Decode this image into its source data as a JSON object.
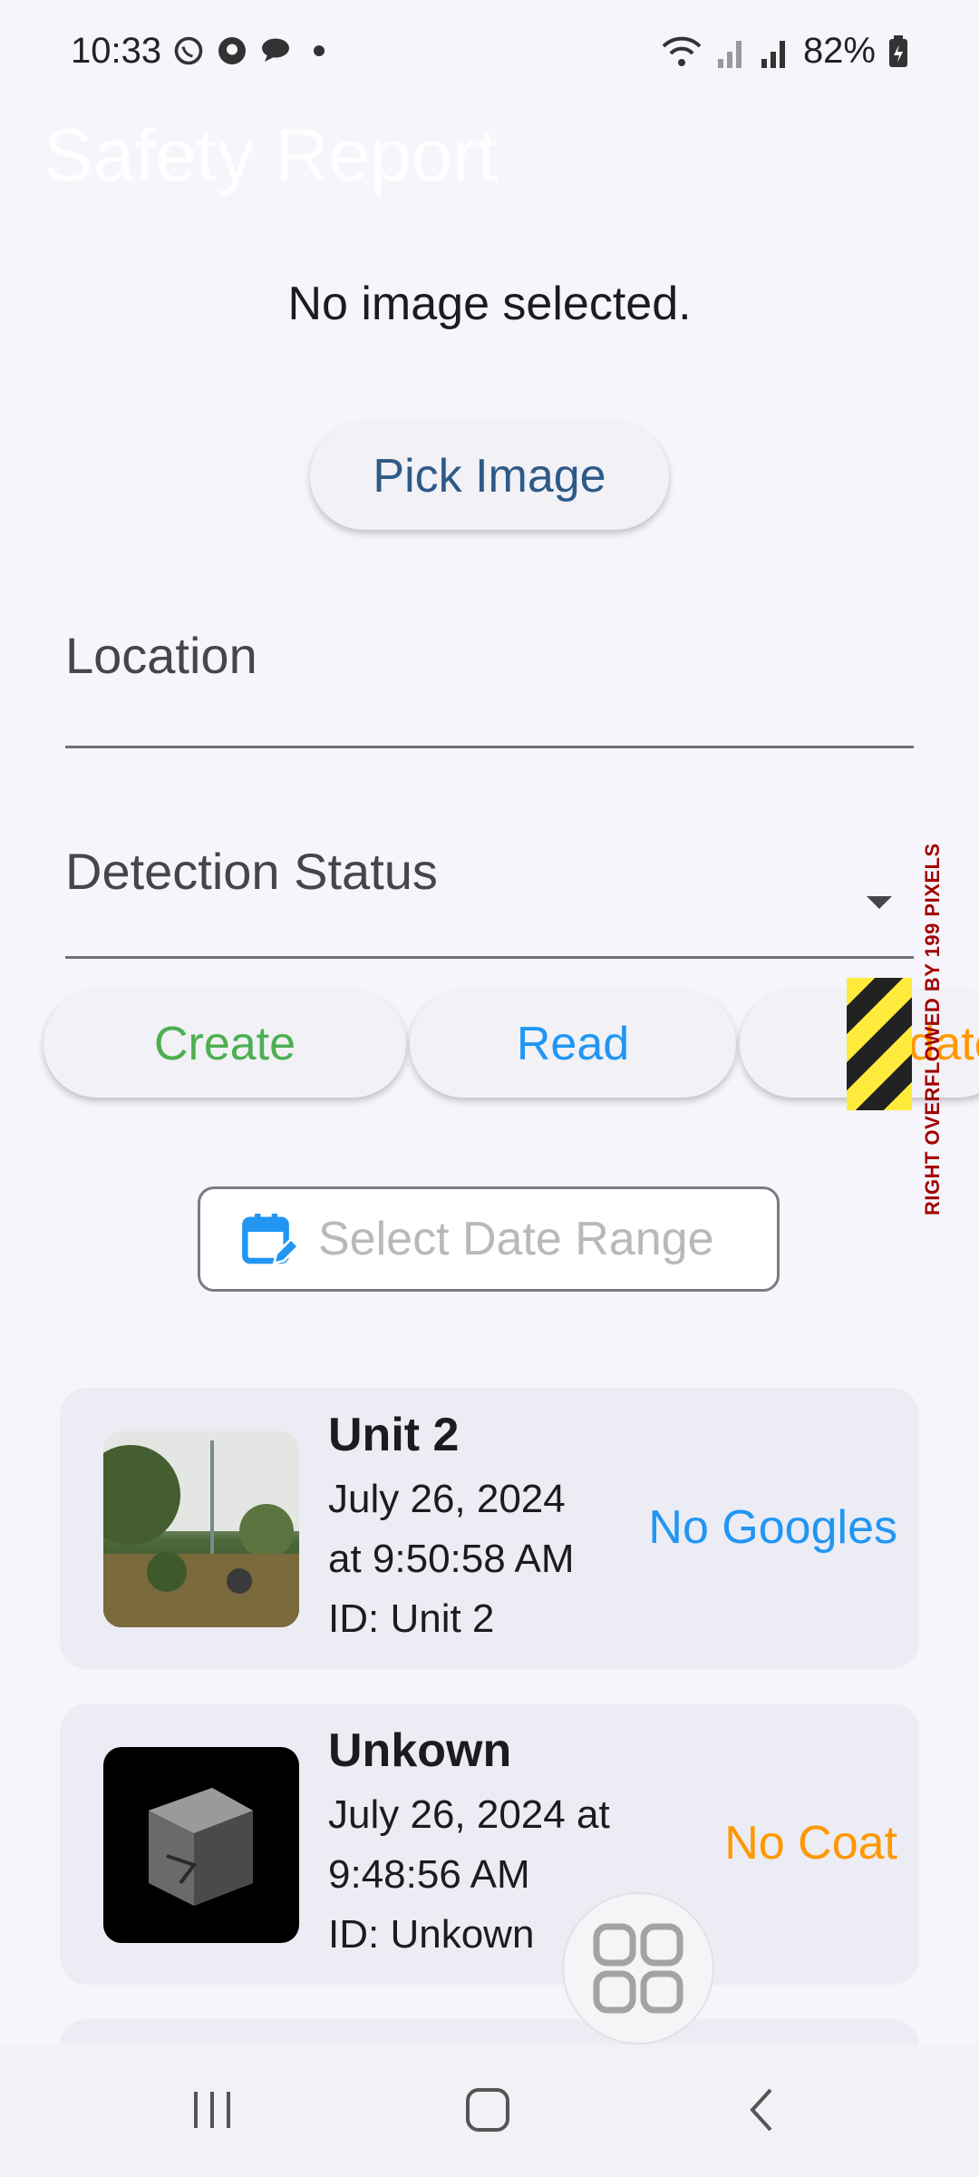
{
  "status_bar": {
    "time": "10:33",
    "battery": "82%",
    "icons_left": [
      "whatsapp-icon",
      "github-icon",
      "chat-icon",
      "dot-icon"
    ],
    "icons_right": [
      "wifi-icon",
      "signal-icon",
      "signal-icon",
      "battery-icon"
    ]
  },
  "app_bar": {
    "title": "Safety Report"
  },
  "image": {
    "status": "No image selected.",
    "pick_label": "Pick Image"
  },
  "form": {
    "location_label": "Location",
    "detection_status_label": "Detection Status"
  },
  "actions": {
    "create": "Create",
    "read": "Read",
    "update": "Update"
  },
  "overflow_warning": "RIGHT OVERFLOWED BY 199 PIXELS",
  "date_range": {
    "label": "Select Date Range"
  },
  "reports": [
    {
      "title": "Unit 2",
      "line1": "July 26, 2024",
      "line2": "at 9:50:58 AM",
      "id": "ID: Unit 2",
      "status": "No Googles",
      "status_color": "#2196f3"
    },
    {
      "title": "Unkown",
      "line1": "July 26, 2024 at",
      "line2": "9:48:56 AM",
      "id": "ID: Unkown",
      "status": "No Coat",
      "status_color": "#ff9800"
    }
  ],
  "colors": {
    "background": "#f5f5fb",
    "create": "#4caf50",
    "read": "#2196f3",
    "update": "#ff9800",
    "pick": "#2e5a87"
  }
}
